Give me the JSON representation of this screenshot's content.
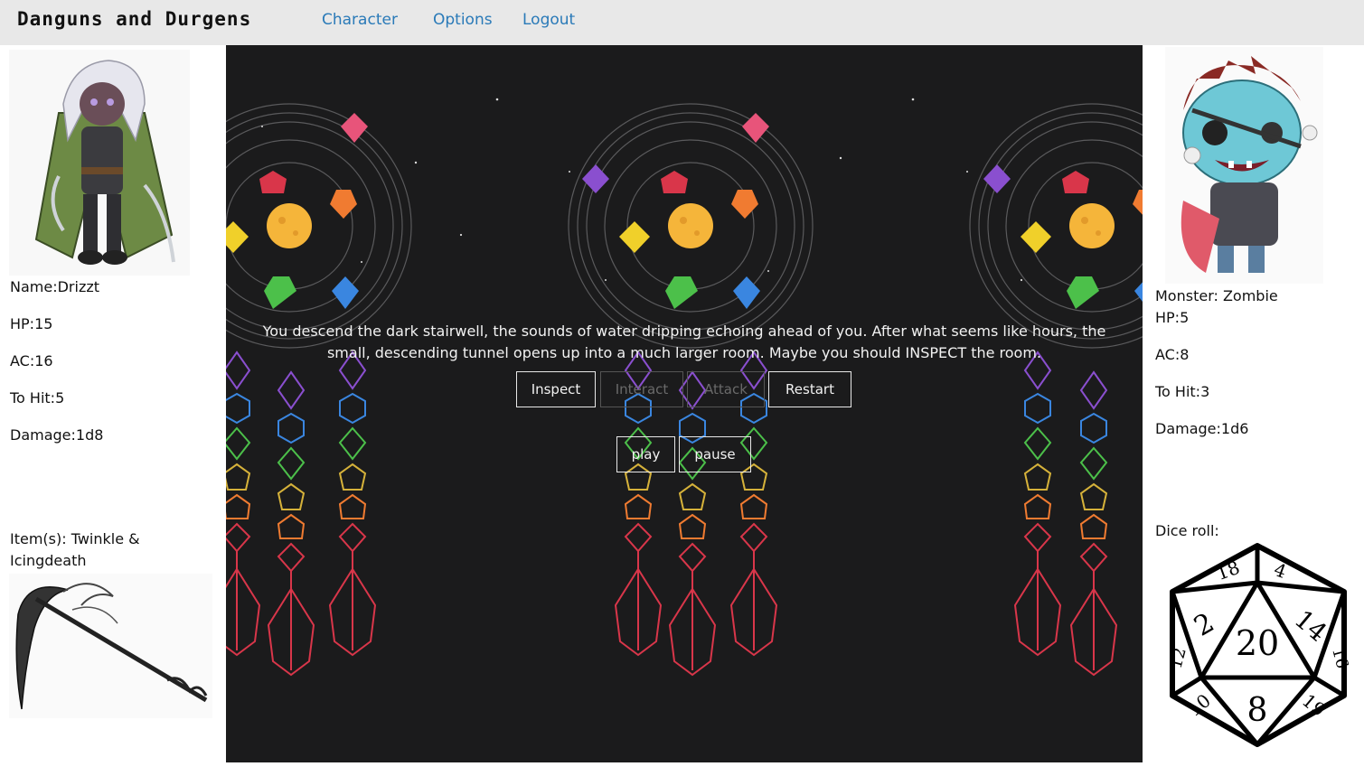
{
  "nav": {
    "brand": "Danguns and Durgens",
    "links": [
      "Character",
      "Options",
      "Logout"
    ]
  },
  "character": {
    "name": "Name:Drizzt",
    "hp": "HP:15",
    "ac": "AC:16",
    "to_hit": "To Hit:5",
    "damage": "Damage:1d8",
    "items": "Item(s): Twinkle & Icingdeath"
  },
  "monster": {
    "name": "Monster: Zombie",
    "hp": "HP:5",
    "ac": "AC:8",
    "to_hit": "To Hit:3",
    "damage": "Damage:1d6",
    "dice_label": "Dice roll:",
    "dice_faces": [
      "20",
      "8",
      "2",
      "14",
      "18",
      "4",
      "12",
      "16",
      "10",
      "19"
    ]
  },
  "game": {
    "narration": "You descend the dark stairwell, the sounds of water dripping echoing ahead of you. After what seems like hours, the small, descending tunnel opens up into a much larger room. Maybe you should INSPECT the room.",
    "actions": {
      "inspect": "Inspect",
      "interact": "Interact",
      "attack": "Attack",
      "restart": "Restart"
    },
    "audio": {
      "play": "play",
      "pause": "pause"
    }
  },
  "colors": {
    "nav_bg": "#e8e8e8",
    "link": "#2a7ab8",
    "game_bg": "#1b1b1c",
    "sun": "#f5b53a"
  }
}
